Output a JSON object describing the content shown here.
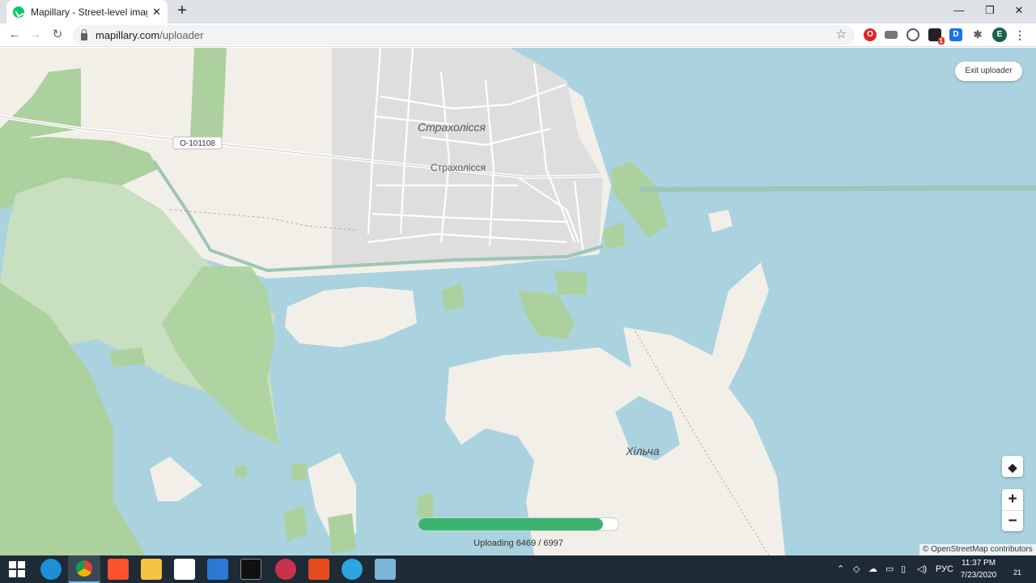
{
  "browser": {
    "tab_title": "Mapillary - Street-level imagery, ",
    "tab_close": "✕",
    "new_tab": "+",
    "url_host": "mapillary.com",
    "url_path": "/uploader",
    "star": "☆",
    "window_minimize": "—",
    "window_restore": "❐",
    "window_close": "✕",
    "profile_initial": "E",
    "ext_badge": "1"
  },
  "map": {
    "labels": {
      "village_italic": "Страхолісся",
      "village_street": "Страхолісся",
      "road_ref": "O-101108",
      "island_name": "Хільча"
    },
    "exit_button": "Exit uploader",
    "layers_icon": "layers-icon",
    "zoom_in": "+",
    "zoom_out": "−",
    "attribution": "© OpenStreetMap contributors",
    "colors": {
      "water": "#aad3df",
      "land": "#f2efe9",
      "forest": "#add19e",
      "urban": "#dddddd",
      "progress": "#3cb371"
    }
  },
  "uploader": {
    "progress_text": "Uploading 6469 / 6997",
    "uploaded": 6469,
    "total": 6997
  },
  "taskbar": {
    "lang": "РУС",
    "time": "11:37 PM",
    "date": "7/23/2020",
    "notification_count": "21"
  }
}
